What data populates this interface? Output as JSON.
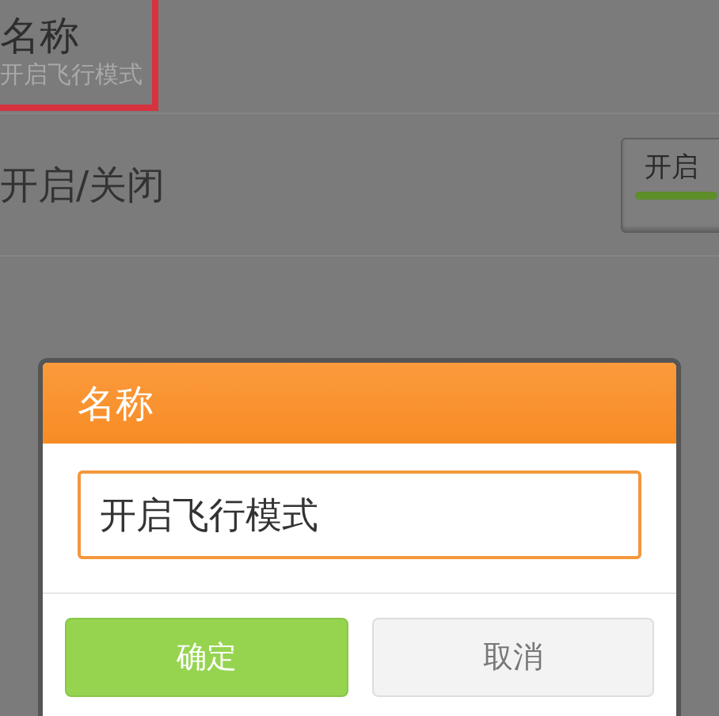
{
  "settings": [
    {
      "kind": "text",
      "title": "名称",
      "subtitle": "开启飞行模式",
      "highlighted": true
    },
    {
      "kind": "toggle",
      "title": "开启/关闭",
      "toggle": {
        "label": "开启",
        "on": true
      }
    }
  ],
  "dialog": {
    "title": "名称",
    "input": {
      "value": "开启飞行模式"
    },
    "buttons": [
      {
        "label": "确定",
        "kind": "primary"
      },
      {
        "label": "取消",
        "kind": "secondary"
      }
    ]
  }
}
